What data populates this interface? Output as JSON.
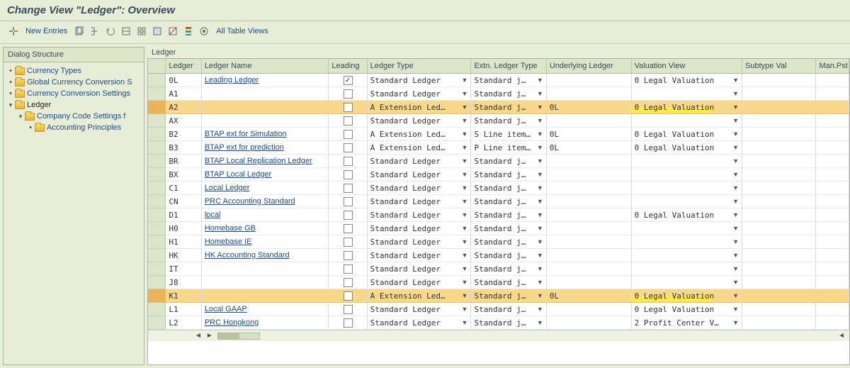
{
  "title": "Change View \"Ledger\": Overview",
  "toolbar": {
    "new_entries": "New Entries",
    "all_table_views": "All Table Views"
  },
  "dialog_structure_header": "Dialog Structure",
  "tree": [
    {
      "level": 1,
      "bullet": true,
      "label": "Currency Types"
    },
    {
      "level": 1,
      "bullet": true,
      "label": "Global Currency Conversion S"
    },
    {
      "level": 1,
      "bullet": true,
      "label": "Currency Conversion Settings"
    },
    {
      "level": 1,
      "toggle": "▾",
      "label": "Ledger",
      "selected": true
    },
    {
      "level": 2,
      "toggle": "▾",
      "label": "Company Code Settings f"
    },
    {
      "level": 3,
      "bullet": true,
      "label": "Accounting Principles"
    }
  ],
  "grid_label": "Ledger",
  "columns": {
    "ledger": "Ledger",
    "ledger_name": "Ledger Name",
    "leading": "Leading",
    "ledger_type": "Ledger Type",
    "extn_type": "Extn. Ledger Type",
    "underlying": "Underlying Ledger",
    "valuation": "Valuation View",
    "subtype": "Subtype Val",
    "manpst": "Man.Pst"
  },
  "rows": [
    {
      "ledger": "0L",
      "name": "Leading Ledger",
      "leading": true,
      "type": "Standard Ledger",
      "ext": "Standard j…",
      "und": "",
      "val": "0 Legal Valuation",
      "sel": false
    },
    {
      "ledger": "A1",
      "name": "",
      "leading": false,
      "type": "Standard Ledger",
      "ext": "Standard j…",
      "und": "",
      "val": "",
      "sel": false
    },
    {
      "ledger": "A2",
      "name": "",
      "leading": false,
      "type": "A Extension Led…",
      "ext": "Standard j…",
      "und": "0L",
      "val": "0 Legal Valuation",
      "sel": true,
      "hl": true
    },
    {
      "ledger": "AX",
      "name": "",
      "leading": false,
      "type": "Standard Ledger",
      "ext": "Standard j…",
      "und": "",
      "val": "",
      "sel": false
    },
    {
      "ledger": "B2",
      "name": "BTAP ext for Simulation",
      "leading": false,
      "type": "A Extension Led…",
      "ext": "S Line item…",
      "und": "0L",
      "val": "0 Legal Valuation",
      "sel": false
    },
    {
      "ledger": "B3",
      "name": "BTAP ext for prediction",
      "leading": false,
      "type": "A Extension Led…",
      "ext": "P Line item…",
      "und": "0L",
      "val": "0 Legal Valuation",
      "sel": false
    },
    {
      "ledger": "BR",
      "name": "BTAP Local Replication Ledger",
      "leading": false,
      "type": "Standard Ledger",
      "ext": "Standard j…",
      "und": "",
      "val": "",
      "sel": false
    },
    {
      "ledger": "BX",
      "name": "BTAP Local Ledger",
      "leading": false,
      "type": "Standard Ledger",
      "ext": "Standard j…",
      "und": "",
      "val": "",
      "sel": false
    },
    {
      "ledger": "C1",
      "name": "Local Ledger",
      "leading": false,
      "type": "Standard Ledger",
      "ext": "Standard j…",
      "und": "",
      "val": "",
      "sel": false
    },
    {
      "ledger": "CN",
      "name": "PRC Accounting Standard",
      "leading": false,
      "type": "Standard Ledger",
      "ext": "Standard j…",
      "und": "",
      "val": "",
      "sel": false
    },
    {
      "ledger": "D1",
      "name": "local",
      "leading": false,
      "type": "Standard Ledger",
      "ext": "Standard j…",
      "und": "",
      "val": "0 Legal Valuation",
      "sel": false
    },
    {
      "ledger": "H0",
      "name": "Homebase GB",
      "leading": false,
      "type": "Standard Ledger",
      "ext": "Standard j…",
      "und": "",
      "val": "",
      "sel": false
    },
    {
      "ledger": "H1",
      "name": "Homebase IE",
      "leading": false,
      "type": "Standard Ledger",
      "ext": "Standard j…",
      "und": "",
      "val": "",
      "sel": false
    },
    {
      "ledger": "HK",
      "name": "HK Accounting Standard",
      "leading": false,
      "type": "Standard Ledger",
      "ext": "Standard j…",
      "und": "",
      "val": "",
      "sel": false
    },
    {
      "ledger": "IT",
      "name": "",
      "leading": false,
      "type": "Standard Ledger",
      "ext": "Standard j…",
      "und": "",
      "val": "",
      "sel": false
    },
    {
      "ledger": "J8",
      "name": "",
      "leading": false,
      "type": "Standard Ledger",
      "ext": "Standard j…",
      "und": "",
      "val": "",
      "sel": false
    },
    {
      "ledger": "K1",
      "name": "",
      "leading": false,
      "type": "A Extension Led…",
      "ext": "Standard j…",
      "und": "0L",
      "val": "0 Legal Valuation",
      "sel": true,
      "hl": true
    },
    {
      "ledger": "L1",
      "name": "Local GAAP",
      "leading": false,
      "type": "Standard Ledger",
      "ext": "Standard j…",
      "und": "",
      "val": "0 Legal Valuation",
      "sel": false
    },
    {
      "ledger": "L2",
      "name": "PRC Hongkong",
      "leading": false,
      "type": "Standard Ledger",
      "ext": "Standard j…",
      "und": "",
      "val": "2 Profit Center V…",
      "sel": false
    }
  ]
}
